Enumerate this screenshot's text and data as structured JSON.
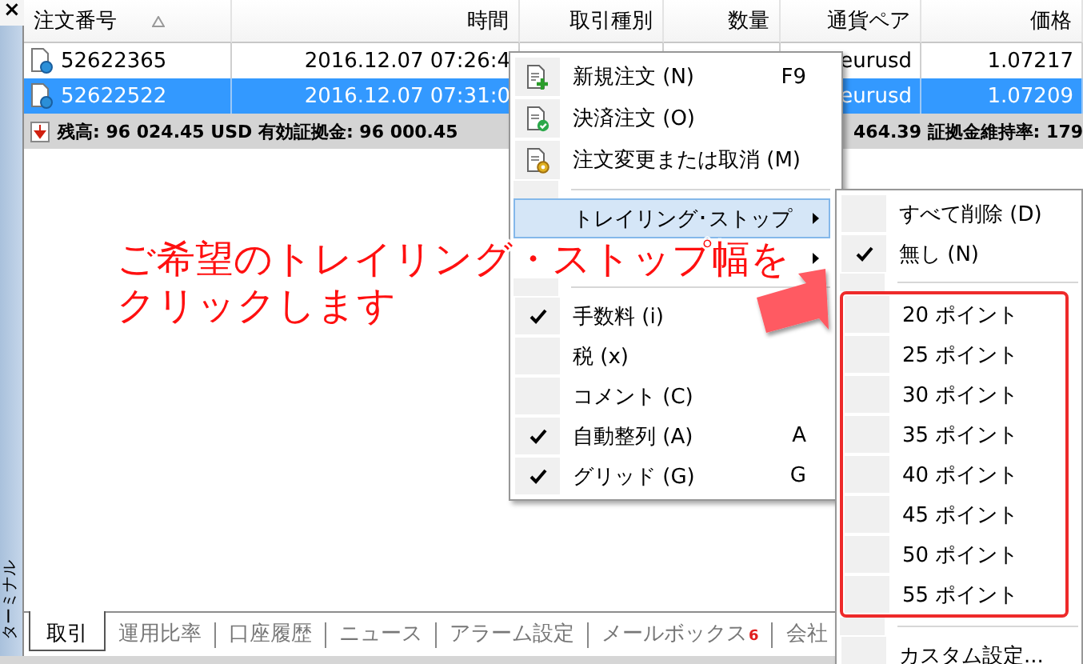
{
  "sidebar": {
    "close": "×",
    "label": "ターミナル"
  },
  "table": {
    "columns": [
      {
        "label": "注文番号",
        "sorted": true
      },
      {
        "label": "時間",
        "sorted": false
      },
      {
        "label": "取引種別",
        "sorted": false
      },
      {
        "label": "数量",
        "sorted": false
      },
      {
        "label": "通貨ペア",
        "sorted": false
      },
      {
        "label": "価格",
        "sorted": false
      }
    ],
    "rows": [
      {
        "selected": false,
        "order": "52622365",
        "time": "2016.12.07 07:26:4",
        "pair": "eurusd",
        "price": "1.07217"
      },
      {
        "selected": true,
        "order": "52622522",
        "time": "2016.12.07 07:31:0",
        "pair": "eurusd",
        "price": "1.07209"
      }
    ],
    "summary": {
      "left": "残高: 96 024.45 USD  有効証拠金: 96 000.45",
      "right": "464.39  証拠金維持率: 179"
    }
  },
  "menu": {
    "items": [
      {
        "kind": "action",
        "label": "新規注文 (N)",
        "shortcut": "F9",
        "selected": false
      },
      {
        "kind": "action",
        "label": "決済注文 (O)",
        "selected": false
      },
      {
        "kind": "action",
        "label": "注文変更または取消 (M)",
        "selected": false
      },
      {
        "kind": "separator"
      },
      {
        "kind": "submenu",
        "label": "トレイリング･ストップ",
        "selected": true
      },
      {
        "kind": "submenu",
        "selected": false
      },
      {
        "kind": "separator"
      },
      {
        "kind": "toggle",
        "label": "手数料 (i)",
        "checked": true,
        "selected": false
      },
      {
        "kind": "toggle",
        "label": "税 (x)",
        "checked": false,
        "selected": false
      },
      {
        "kind": "toggle",
        "label": "コメント (C)",
        "checked": false,
        "selected": false
      },
      {
        "kind": "toggle",
        "label": "自動整列 (A)",
        "shortcut": "A",
        "checked": true,
        "selected": false
      },
      {
        "kind": "toggle",
        "label": "グリッド (G)",
        "shortcut": "G",
        "checked": true,
        "selected": false
      }
    ]
  },
  "submenu": {
    "items": [
      {
        "kind": "toggle",
        "label": "すべて削除 (D)",
        "checked": false,
        "selected": false
      },
      {
        "kind": "toggle",
        "label": "無し (N)",
        "checked": true,
        "selected": false
      },
      {
        "kind": "separator"
      },
      {
        "kind": "group",
        "items": [
          {
            "kind": "toggle",
            "label": "20 ポイント",
            "checked": false,
            "selected": false
          },
          {
            "kind": "toggle",
            "label": "25 ポイント",
            "checked": false,
            "selected": false
          },
          {
            "kind": "toggle",
            "label": "30 ポイント",
            "checked": false,
            "selected": false
          },
          {
            "kind": "toggle",
            "label": "35 ポイント",
            "checked": false,
            "selected": false
          },
          {
            "kind": "toggle",
            "label": "40 ポイント",
            "checked": false,
            "selected": false
          },
          {
            "kind": "toggle",
            "label": "45 ポイント",
            "checked": false,
            "selected": false
          },
          {
            "kind": "toggle",
            "label": "50 ポイント",
            "checked": false,
            "selected": false
          },
          {
            "kind": "toggle",
            "label": "55 ポイント",
            "checked": false,
            "selected": false
          }
        ]
      },
      {
        "kind": "separator"
      },
      {
        "kind": "toggle",
        "label": "カスタム設定...",
        "checked": false,
        "selected": false
      }
    ]
  },
  "tabs": [
    {
      "label": "取引",
      "selected": true
    },
    {
      "label": "運用比率",
      "selected": false
    },
    {
      "label": "口座履歴",
      "selected": false
    },
    {
      "label": "ニュース",
      "selected": false
    },
    {
      "label": "アラーム設定",
      "selected": false
    },
    {
      "label": "メールボックス",
      "badge": "6",
      "selected": false
    },
    {
      "label": "会社",
      "selected": false
    }
  ],
  "annotation": {
    "lines": [
      "ご希望のトレイリング・ストップ幅を",
      "クリックします"
    ]
  }
}
